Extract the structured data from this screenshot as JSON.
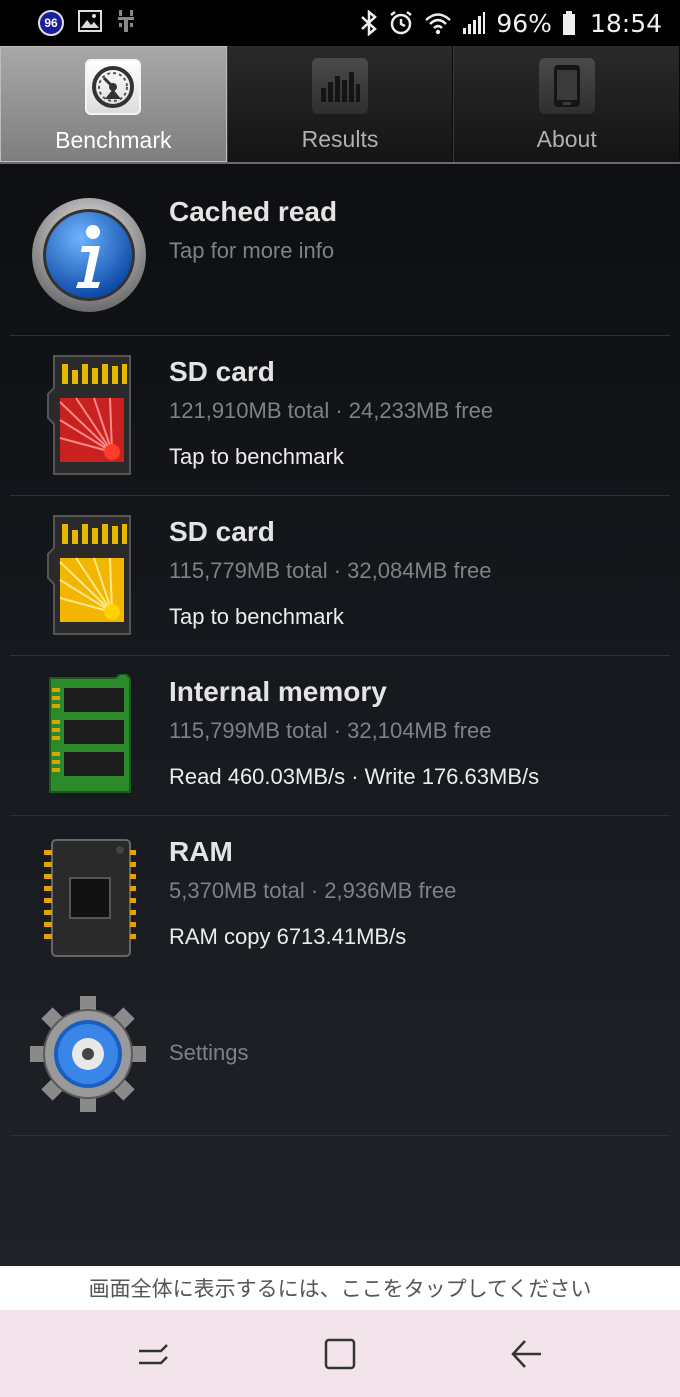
{
  "status_bar": {
    "notification_badge": "96",
    "battery_percent": "96%",
    "time": "18:54",
    "icons": [
      "gallery-icon",
      "usb-icon",
      "bluetooth-icon",
      "alarm-icon",
      "wifi-icon",
      "signal-icon",
      "battery-icon"
    ]
  },
  "tabs": [
    {
      "label": "Benchmark",
      "icon": "speedometer-icon",
      "active": true
    },
    {
      "label": "Results",
      "icon": "bar-chart-icon",
      "active": false
    },
    {
      "label": "About",
      "icon": "phone-icon",
      "active": false
    }
  ],
  "items": [
    {
      "title": "Cached read",
      "subtitle": "Tap for more info",
      "extra": "",
      "icon": "info-icon"
    },
    {
      "title": "SD card",
      "subtitle": "121,910MB total · 24,233MB free",
      "extra": "Tap to benchmark",
      "icon": "sd-card-red-icon"
    },
    {
      "title": "SD card",
      "subtitle": "115,779MB total · 32,084MB free",
      "extra": "Tap to benchmark",
      "icon": "sd-card-yellow-icon"
    },
    {
      "title": "Internal memory",
      "subtitle": "115,799MB total · 32,104MB free",
      "extra": "Read 460.03MB/s · Write 176.63MB/s",
      "icon": "memory-module-icon"
    },
    {
      "title": "RAM",
      "subtitle": "5,370MB total · 2,936MB free",
      "extra": "RAM copy 6713.41MB/s",
      "icon": "ram-chip-icon"
    }
  ],
  "settings": {
    "label": "Settings",
    "icon": "gear-icon"
  },
  "banner": {
    "text": "画面全体に表示するには、ここをタップしてください"
  },
  "navbar": {
    "icons": [
      "recent-apps-icon",
      "home-icon",
      "back-icon"
    ]
  },
  "colors": {
    "background": "#0d0f12",
    "active_tab": "#9a9a9a",
    "nav_bar": "#f3e4ec",
    "info_blue": "#1f6fd0"
  }
}
